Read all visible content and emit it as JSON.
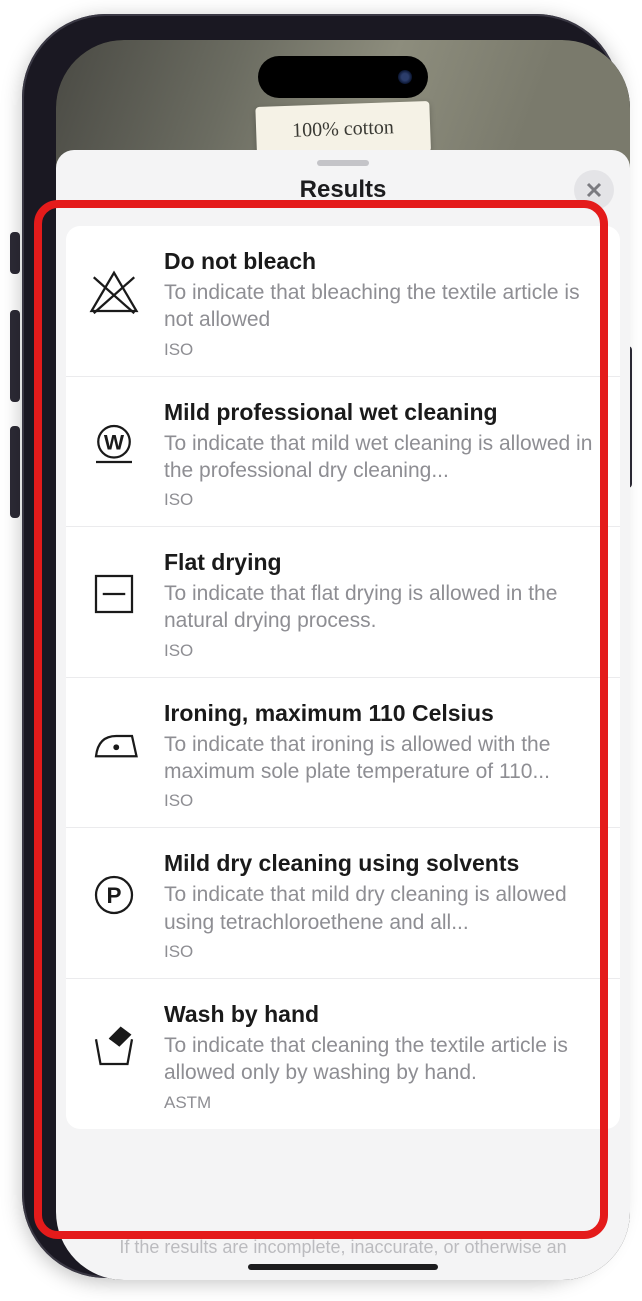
{
  "photo_label": "100% cotton",
  "sheet": {
    "title": "Results",
    "footer": "If the results are incomplete, inaccurate, or otherwise an"
  },
  "items": [
    {
      "icon": "do-not-bleach-icon",
      "title": "Do not bleach",
      "description": "To indicate that bleaching the textile article is not allowed",
      "standard": "ISO"
    },
    {
      "icon": "wet-cleaning-mild-icon",
      "title": "Mild professional wet cleaning",
      "description": "To indicate that mild wet cleaning is allowed in the professional dry cleaning...",
      "standard": "ISO"
    },
    {
      "icon": "flat-drying-icon",
      "title": "Flat drying",
      "description": "To indicate that flat drying is allowed in the natural drying process.",
      "standard": "ISO"
    },
    {
      "icon": "iron-110-icon",
      "title": "Ironing, maximum 110 Celsius",
      "description": "To indicate that ironing is allowed with the maximum sole plate temperature of 110...",
      "standard": "ISO"
    },
    {
      "icon": "dry-clean-p-icon",
      "title": "Mild dry cleaning using solvents",
      "description": "To indicate that mild dry cleaning is allowed using tetrachloroethene and all...",
      "standard": "ISO"
    },
    {
      "icon": "hand-wash-icon",
      "title": "Wash by hand",
      "description": "To indicate that cleaning the textile article is allowed only by washing by hand.",
      "standard": "ASTM"
    }
  ]
}
